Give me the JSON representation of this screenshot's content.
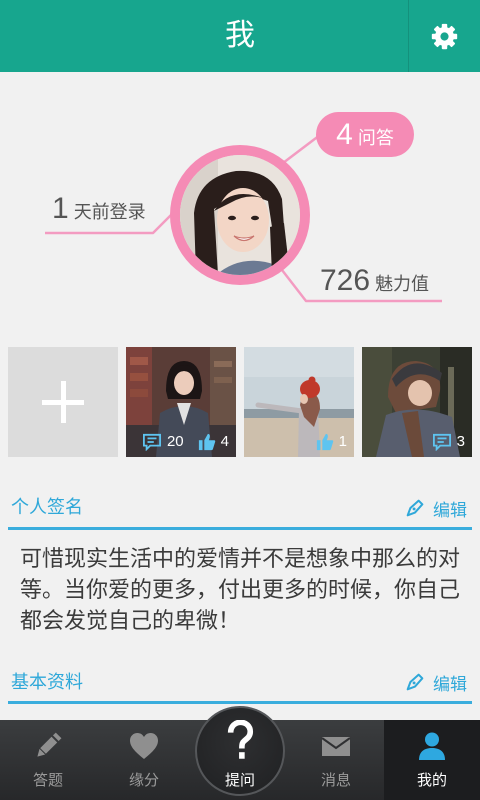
{
  "colors": {
    "header_bg": "#17a68e",
    "accent_pink": "#f58bb5",
    "connector_pink": "#f39bc1",
    "section_blue": "#2fa8d9",
    "page_bg": "#f1f1f1",
    "nav_active_icon": "#2ea8e0",
    "stat_icon": "#5ec4f0"
  },
  "header": {
    "title": "我",
    "settings_icon": "gear-icon"
  },
  "profile": {
    "avatar_icon": "avatar-photo",
    "last_login": {
      "value": "1",
      "label": "天前登录"
    },
    "qa": {
      "value": "4",
      "label": "问答"
    },
    "charm": {
      "value": "726",
      "label": "魅力值"
    }
  },
  "photos": {
    "add_icon": "plus-icon",
    "comment_icon": "comment-icon",
    "like_icon": "thumbs-up-icon",
    "items": [
      {
        "comments": "20",
        "likes": "4"
      },
      {
        "likes": "1"
      },
      {
        "comments": "3"
      }
    ]
  },
  "signature": {
    "title": "个人签名",
    "edit_label": "编辑",
    "edit_icon": "pen-icon",
    "text": "可惜现实生活中的爱情并不是想象中那么的对等。当你爱的更多，付出更多的时候，你自己都会发觉自己的卑微！"
  },
  "basic_info": {
    "title": "基本资料",
    "edit_label": "编辑",
    "edit_icon": "pen-icon"
  },
  "nav": {
    "items": [
      {
        "label": "答题",
        "icon": "pencil-icon"
      },
      {
        "label": "缘分",
        "icon": "heart-icon"
      },
      {
        "label": "提问",
        "icon": "question-mark-icon"
      },
      {
        "label": "消息",
        "icon": "envelope-icon"
      },
      {
        "label": "我的",
        "icon": "person-icon",
        "active": true
      }
    ]
  }
}
